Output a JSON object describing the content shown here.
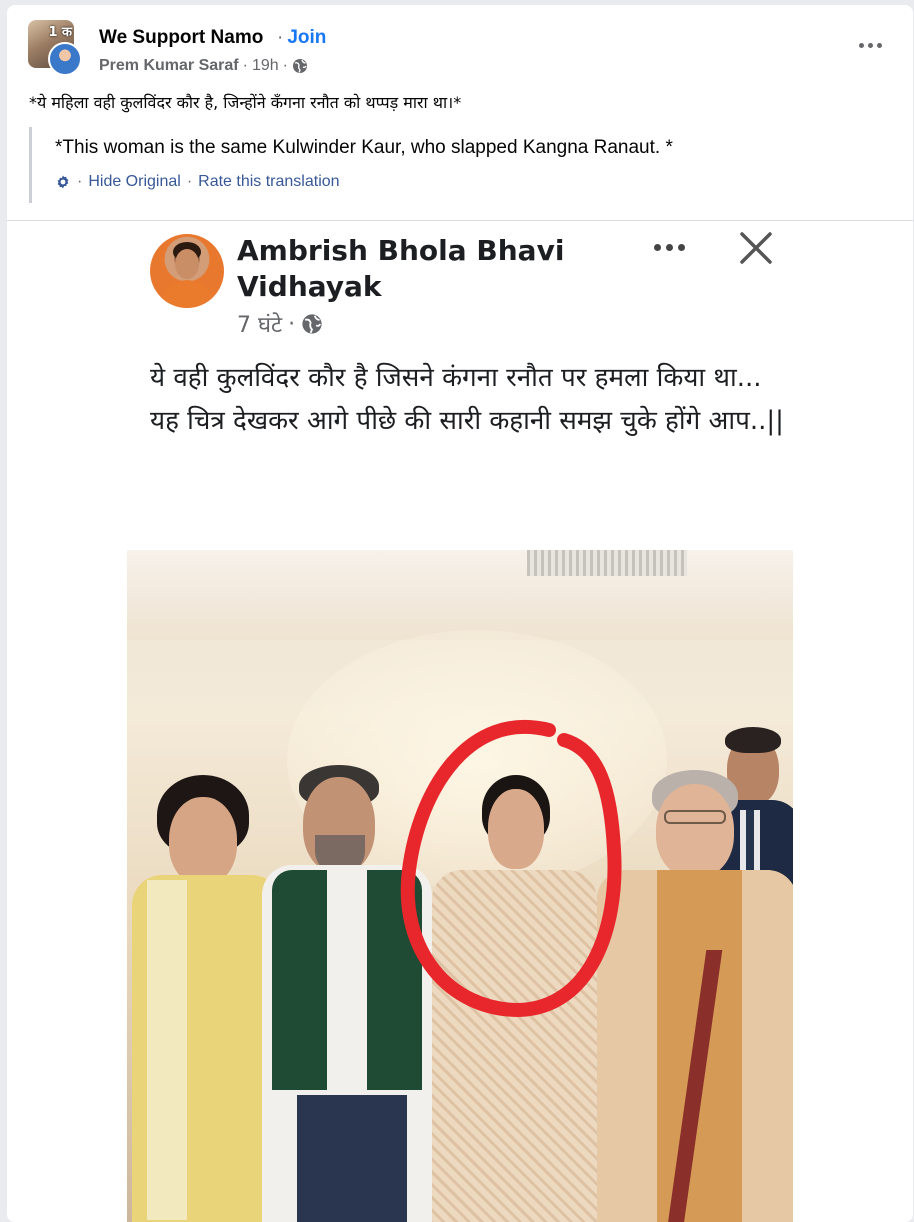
{
  "header": {
    "group_avatar_tag": "1 क",
    "group_name": "We Support Namo",
    "join_separator": "·",
    "join_label": "Join",
    "author": "Prem Kumar Saraf",
    "meta_separator": "·",
    "time": "19h",
    "privacy_icon": "globe-icon",
    "more_icon": "more-options-icon"
  },
  "post": {
    "text": "*ये महिला वही कुलविंदर कौर है, जिन्होंने कँगना रनौत को थप्पड़ मारा था।*",
    "translation": {
      "text": "*This woman is the same Kulwinder Kaur, who slapped Kangna Ranaut. *",
      "settings_icon": "gear-icon",
      "hide_original": "Hide Original",
      "separator_1": "·",
      "separator_2": "·",
      "rate": "Rate this translation"
    }
  },
  "embedded": {
    "name": "Ambrish Bhola Bhavi Vidhayak",
    "time": "7 घंटे",
    "meta_separator": "·",
    "line1": "ये वही कुलविंदर कौर है जिसने कंगना रनौत पर हमला किया था...",
    "line2": "यह चित्र देखकर आगे पीछे की सारी कहानी समझ चुके होंगे आप..||"
  },
  "colors": {
    "link": "#1877f2",
    "translation_link": "#385898",
    "secondary_text": "#65676b",
    "highlight_circle": "#e8272c"
  }
}
